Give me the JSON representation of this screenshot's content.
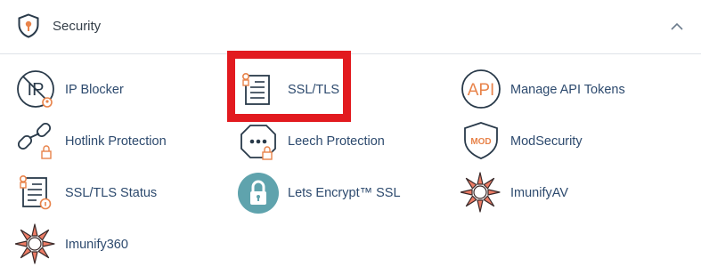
{
  "section": {
    "title": "Security",
    "header_icon": "shield-icon",
    "toggle_icon": "chevron-up-icon"
  },
  "items": [
    {
      "label": "IP Blocker",
      "icon": "ip-blocker-icon"
    },
    {
      "label": "SSL/TLS",
      "icon": "ssl-tls-icon"
    },
    {
      "label": "Manage API Tokens",
      "icon": "api-icon"
    },
    {
      "label": "Hotlink Protection",
      "icon": "hotlink-icon"
    },
    {
      "label": "Leech Protection",
      "icon": "leech-icon"
    },
    {
      "label": "ModSecurity",
      "icon": "modsecurity-icon"
    },
    {
      "label": "SSL/TLS Status",
      "icon": "ssl-status-icon"
    },
    {
      "label": "Lets Encrypt™ SSL",
      "icon": "lets-encrypt-icon"
    },
    {
      "label": "ImunifyAV",
      "icon": "imunify-icon"
    },
    {
      "label": "Imunify360",
      "icon": "imunify-icon"
    }
  ],
  "icon_text": {
    "ip": "IP",
    "api": "API",
    "mod": "MOD"
  },
  "colors": {
    "accent_orange": "#e8834a",
    "icon_dark": "#293a4a",
    "label_text": "#2d4a6e",
    "highlight_red": "#e21a1f",
    "lets_encrypt_teal": "#5fa3ad",
    "imunify_salmon": "#ef7d66"
  }
}
